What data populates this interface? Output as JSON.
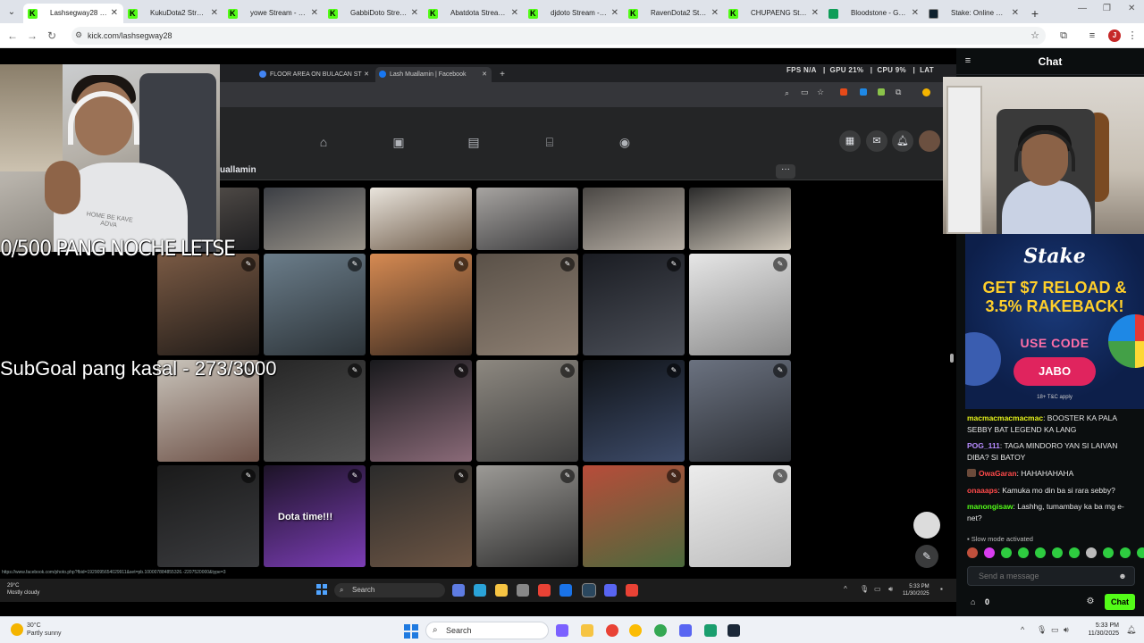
{
  "browser": {
    "tabs": [
      {
        "title": "Lashsegway28 Stream",
        "icon": "kick",
        "active": true
      },
      {
        "title": "KukuDota2 Stream",
        "icon": "kick",
        "active": false
      },
      {
        "title": "yowe Stream - Watch",
        "icon": "kick",
        "active": false
      },
      {
        "title": "GabbiDoto Stream",
        "icon": "kick",
        "active": false
      },
      {
        "title": "Abatdota Stream - W",
        "icon": "kick",
        "active": false
      },
      {
        "title": "djdoto Stream - Watc",
        "icon": "kick",
        "active": false
      },
      {
        "title": "RavenDota2 Stream",
        "icon": "kick",
        "active": false
      },
      {
        "title": "CHUPAENG Stream",
        "icon": "kick",
        "active": false
      },
      {
        "title": "Bloodstone - Google",
        "icon": "sheet",
        "active": false
      },
      {
        "title": "Stake: Online Casino",
        "icon": "stake",
        "active": false
      }
    ],
    "url": "kick.com/lashsegway28",
    "profile_initial": "J"
  },
  "stream": {
    "inner_tabs": [
      {
        "title": "FLOOR AREA ON BULACAN ST",
        "icon": "google",
        "active": false
      },
      {
        "title": "Lash Muallamin | Facebook",
        "icon": "facebook",
        "active": true
      }
    ],
    "perf": {
      "fps": "N/A",
      "gpu": "21",
      "cpu": "9"
    },
    "perf_labels": {
      "fps": "FPS",
      "gpu": "GPU",
      "cpu": "CPU",
      "lat": "LAT"
    },
    "profile_name": "uallamin",
    "more_label": "···",
    "grid_caption": "Dota time!!!",
    "status_url": "https://www.facebook.com/photo.php?fbid=1929095654029911&set=pb.100007884855326.-2207520000&type=3",
    "inner_taskbar": {
      "weather_temp": "29°C",
      "weather_desc": "Mostly cloudy",
      "search": "Search",
      "time": "5:33 PM",
      "date": "11/30/2025"
    }
  },
  "overlays": {
    "noche": "0/500 PANG NOCHE LETSE",
    "subgoal": "SubGoal pang kasal - 273/3000",
    "shirt_text": "HOME BE KAVE ADVA"
  },
  "chat": {
    "title": "Chat",
    "ad": {
      "brand": "Stake",
      "headline": "GET $7 RELOAD & 3.5% RAKEBACK!",
      "code_label": "USE CODE",
      "code": "JABO",
      "legal": "18+  T&C apply"
    },
    "messages": [
      {
        "user": "macmacmacmacmac",
        "color": "#e5f21a",
        "text": "BOOSTER KA PALA SEBBY BAT LEGEND KA LANG",
        "badge": false
      },
      {
        "user": "POG_111",
        "color": "#b78cff",
        "text": "TAGA MINDORO YAN SI LAIVAN DIBA? SI BATOY",
        "badge": false
      },
      {
        "user": "OwaGaran",
        "color": "#ff4a4a",
        "text": "HAHAHAHAHA",
        "badge": true
      },
      {
        "user": "onaaaps",
        "color": "#ff4a4a",
        "text": "Kamuka mo din ba si rara sebby?",
        "badge": false
      },
      {
        "user": "manongisaw",
        "color": "#53fc18",
        "text": "Lashhg, tumambay ka ba mg e-net?",
        "badge": false
      }
    ],
    "slow_mode": "Slow mode activated",
    "input_placeholder": "Send a message",
    "points": "0",
    "send_label": "Chat"
  },
  "taskbar": {
    "weather_temp": "30°C",
    "weather_desc": "Partly sunny",
    "search": "Search",
    "time": "5:33 PM",
    "date": "11/30/2025"
  },
  "colors": {
    "kick_green": "#53fc18",
    "stake_pink": "#e0245e",
    "stake_yellow": "#ffcf2a"
  }
}
